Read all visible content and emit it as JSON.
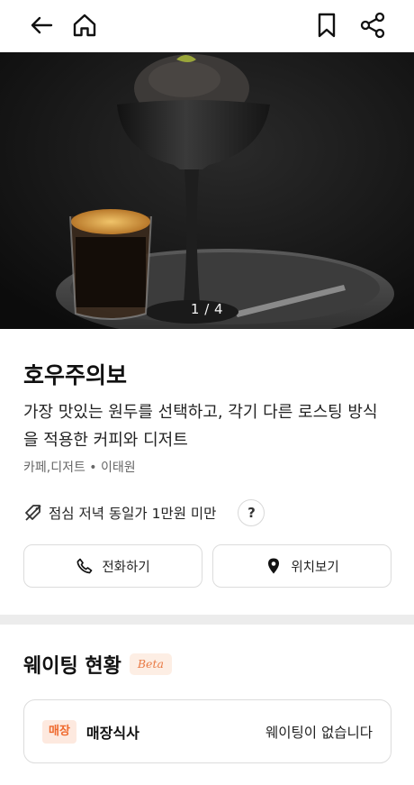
{
  "header": {
    "back_icon": "arrow-left-icon",
    "home_icon": "home-icon",
    "bookmark_icon": "bookmark-icon",
    "share_icon": "share-icon"
  },
  "gallery": {
    "pager": "1 / 4",
    "current": 1,
    "total": 4
  },
  "store": {
    "name": "호우주의보",
    "description": "가장 맛있는 원두를 선택하고, 각기 다른 로스팅 방식을 적용한 커피와 디저트",
    "category_location": "카페,디저트 • 이태원",
    "price_info": "점심 저녁 동일가 1만원 미만",
    "help_label": "?"
  },
  "actions": {
    "call_label": "전화하기",
    "location_label": "위치보기"
  },
  "waiting": {
    "title": "웨이팅 현황",
    "beta_label": "Beta",
    "tag": "매장",
    "type": "매장식사",
    "status": "웨이팅이 없습니다"
  },
  "colors": {
    "accent": "#ef6a2e",
    "tag_bg": "#fde9df",
    "divider": "#ececec"
  }
}
